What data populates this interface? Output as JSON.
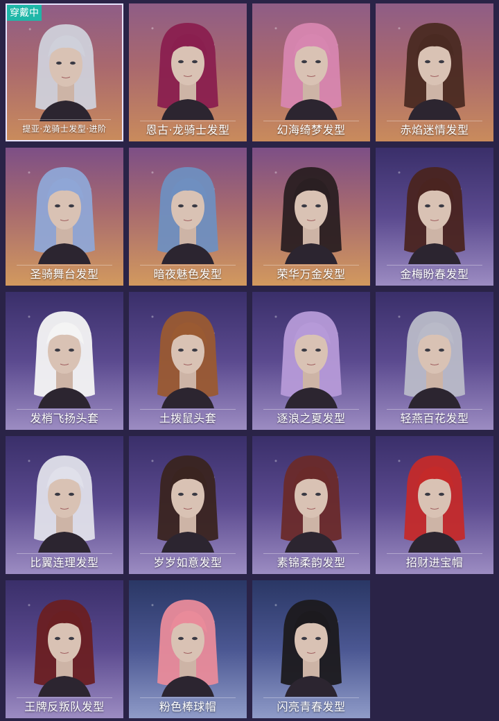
{
  "badge_label": "穿戴中",
  "items": [
    {
      "name": "提亚·龙骑士发型·进阶",
      "icon": "silver-dragon-knight-hair-icon",
      "hair": "#cfd0da",
      "bg": "warm",
      "equipped": true
    },
    {
      "name": "恩古·龙骑士发型",
      "icon": "crimson-dragon-knight-hair-icon",
      "hair": "#8a1f4f",
      "bg": "warm"
    },
    {
      "name": "幻海绮梦发型",
      "icon": "pink-wavy-hair-icon",
      "hair": "#d786b0",
      "bg": "warm"
    },
    {
      "name": "赤焰迷情发型",
      "icon": "brown-wavy-hair-icon",
      "hair": "#4a2a22",
      "bg": "warm"
    },
    {
      "name": "圣骑舞台发型",
      "icon": "blue-long-hair-icon",
      "hair": "#8fa6d6",
      "bg": "warm2"
    },
    {
      "name": "暗夜魅色发型",
      "icon": "blue-ponytail-hair-icon",
      "hair": "#6f8fc0",
      "bg": "warm2"
    },
    {
      "name": "荣华万金发型",
      "icon": "double-bun-hair-icon",
      "hair": "#2a1f22",
      "bg": "warm2"
    },
    {
      "name": "金梅盼春发型",
      "icon": "short-bun-hair-icon",
      "hair": "#4a2420",
      "bg": "purple"
    },
    {
      "name": "发梢飞扬头套",
      "icon": "unicorn-head-mask-icon",
      "hair": "#f4f4f4",
      "bg": "purple"
    },
    {
      "name": "土拨鼠头套",
      "icon": "groundhog-head-mask-icon",
      "hair": "#9a5a32",
      "bg": "purple"
    },
    {
      "name": "逐浪之夏发型",
      "icon": "lavender-ponytail-hair-icon",
      "hair": "#b69ad8",
      "bg": "purple"
    },
    {
      "name": "轻燕百花发型",
      "icon": "silver-braided-hair-icon",
      "hair": "#b9bac8",
      "bg": "purple"
    },
    {
      "name": "比翼连理发型",
      "icon": "silver-feather-hair-icon",
      "hair": "#e0e0ea",
      "bg": "purple"
    },
    {
      "name": "岁岁如意发型",
      "icon": "twin-tails-hair-icon",
      "hair": "#3a2420",
      "bg": "purple"
    },
    {
      "name": "素锦柔韵发型",
      "icon": "red-straight-hair-icon",
      "hair": "#6a2a2a",
      "bg": "purple"
    },
    {
      "name": "招财进宝帽",
      "icon": "red-knit-hat-icon",
      "hair": "#c42a2a",
      "bg": "purple"
    },
    {
      "name": "王牌反叛队发型",
      "icon": "red-high-ponytail-hair-icon",
      "hair": "#6a1f22",
      "bg": "purple"
    },
    {
      "name": "粉色棒球帽",
      "icon": "pink-baseball-cap-icon",
      "hair": "#e98b9a",
      "bg": "blue"
    },
    {
      "name": "闪亮青春发型",
      "icon": "black-bob-hair-icon",
      "hair": "#1c1a1e",
      "bg": "blue"
    }
  ]
}
